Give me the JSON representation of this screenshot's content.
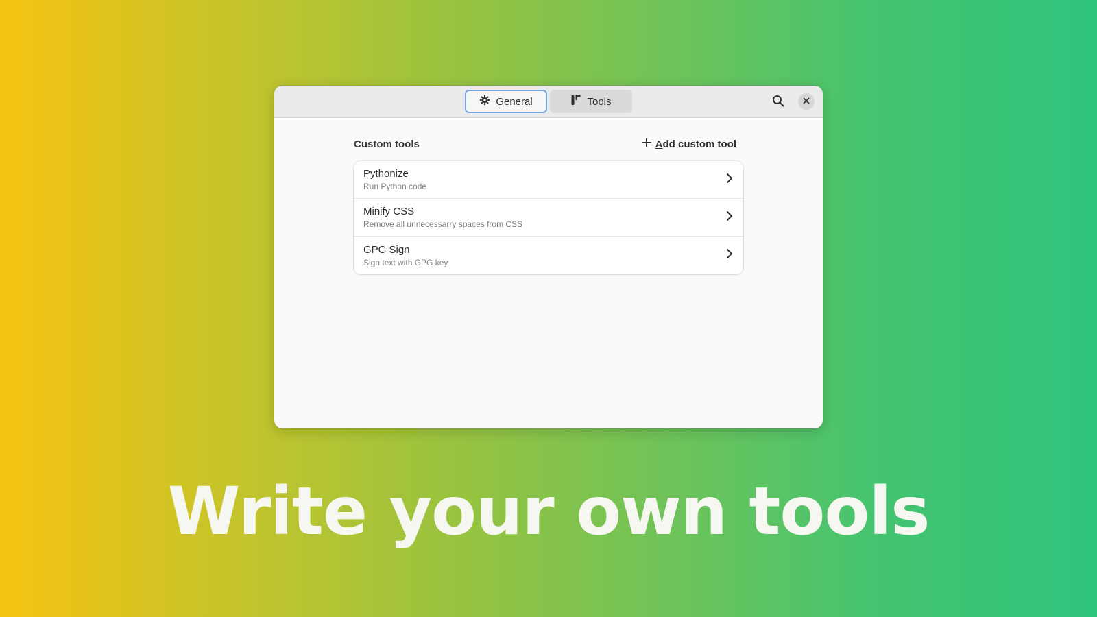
{
  "window": {
    "tabs": [
      {
        "icon": "gear-icon",
        "label_pre": "",
        "label_u": "G",
        "label_post": "eneral"
      },
      {
        "icon": "tools-icon",
        "label_pre": "T",
        "label_u": "o",
        "label_post": "ols"
      }
    ],
    "search_icon": "search-icon",
    "close_icon": "close-icon"
  },
  "custom_tools": {
    "title": "Custom tools",
    "add_button": {
      "icon": "plus-icon",
      "label_u": "A",
      "label_post": "dd custom tool"
    },
    "items": [
      {
        "title": "Pythonize",
        "subtitle": "Run Python code"
      },
      {
        "title": "Minify CSS",
        "subtitle": "Remove all unnecessarry spaces from CSS"
      },
      {
        "title": "GPG Sign",
        "subtitle": "Sign text with GPG key"
      }
    ]
  },
  "headline": "Write your own tools",
  "colors": {
    "gradient_start": "#f6c311",
    "gradient_end": "#2ec47c",
    "focus_ring": "#7aa6e0"
  }
}
